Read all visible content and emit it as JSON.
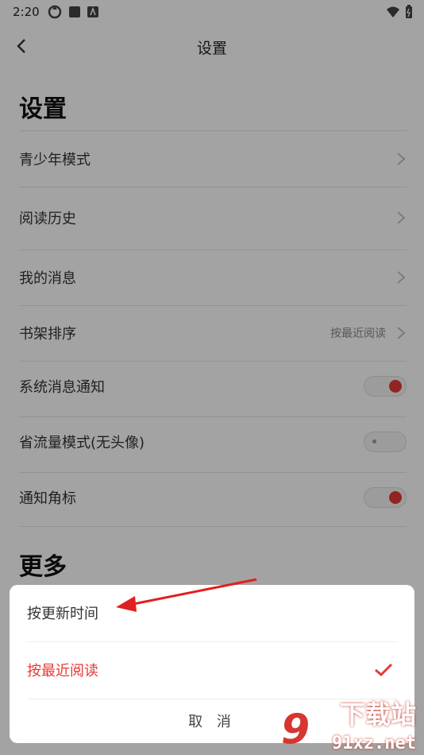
{
  "status_bar": {
    "time": "2:20"
  },
  "nav": {
    "title": "设置"
  },
  "section_settings": {
    "title": "设置"
  },
  "rows": [
    {
      "label": "青少年模式"
    },
    {
      "label": "阅读历史"
    },
    {
      "label": "我的消息"
    },
    {
      "label": "书架排序",
      "value": "按最近阅读"
    },
    {
      "label": "系统消息通知",
      "toggle": "on"
    },
    {
      "label": "省流量模式(无头像)",
      "toggle": "off"
    },
    {
      "label": "通知角标",
      "toggle": "on"
    }
  ],
  "section_more": {
    "title": "更多"
  },
  "sort_sheet": {
    "options": [
      {
        "label": "按更新时间",
        "selected": false
      },
      {
        "label": "按最近阅读",
        "selected": true
      }
    ],
    "cancel_label": "取 消"
  },
  "watermark": {
    "logo": "9",
    "text": "下载站",
    "sub": "91xz.net"
  },
  "colors": {
    "accent": "#e53935",
    "overlay": "rgba(0,0,0,0.36)"
  }
}
